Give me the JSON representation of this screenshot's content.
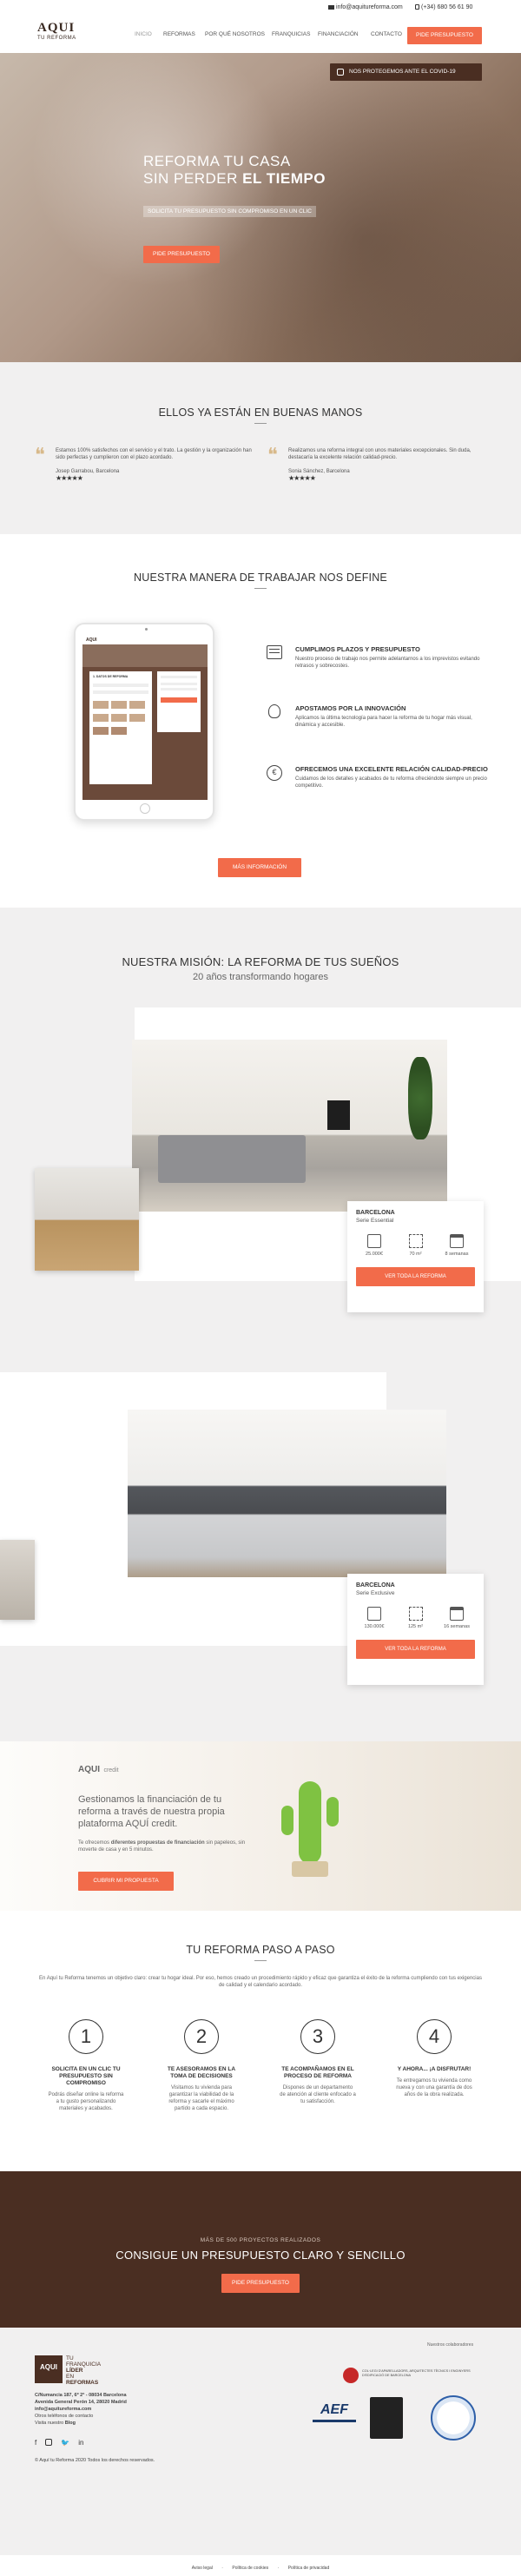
{
  "topbar": {
    "email": "info@aquitureforma.com",
    "phone": "(+34) 680 56 61 90"
  },
  "brand": {
    "logo": "AQUI",
    "tagline": "TU REFORMA"
  },
  "nav": {
    "items": [
      "INICIO",
      "REFORMAS",
      "POR QUÉ NOSOTROS",
      "FRANQUICIAS",
      "FINANCIACIÓN",
      "CONTACTO"
    ],
    "cta": "PIDE PRESUPUESTO"
  },
  "hero": {
    "covid_badge": "NOS PROTEGEMOS ANTE EL COVID-19",
    "title_line1": "REFORMA TU CASA",
    "title_line2_prefix": "SIN PERDER ",
    "title_line2_bold": "EL TIEMPO",
    "subtitle": "SOLICITA TU PRESUPUESTO SIN COMPROMISO EN UN CLIC",
    "cta": "PIDE PRESUPUESTO"
  },
  "testimonials": {
    "title": "ELLOS YA ESTÁN EN BUENAS MANOS",
    "items": [
      {
        "text": "Estamos 100% satisfechos con el servicio y el trato. La gestión y la organización han sido perfectas y cumplieron con el plazo acordado.",
        "author": "Josep Garrabou, Barcelona",
        "stars": "★★★★★"
      },
      {
        "text": "Realizamos una reforma integral con unos materiales excepcionales. Sin duda, destacaría la excelente relación calidad-precio.",
        "author": "Sonia Sánchez, Barcelona",
        "stars": "★★★★★"
      }
    ]
  },
  "method": {
    "title": "NUESTRA MANERA DE TRABAJAR NOS DEFINE",
    "features": [
      {
        "title": "CUMPLIMOS PLAZOS Y PRESUPUESTO",
        "text": "Nuestro proceso de trabajo nos permite adelantarnos a los imprevistos evitando retrasos y sobrecostes."
      },
      {
        "title": "APOSTAMOS POR LA INNOVACIÓN",
        "text": "Aplicamos la última tecnología para hacer la reforma de tu hogar más visual, dinámica y accesible."
      },
      {
        "title": "OFRECEMOS UNA EXCELENTE RELACIÓN CALIDAD-PRECIO",
        "text": "Cuidamos de los detalles y acabados de tu reforma ofreciéndote siempre un precio competitivo."
      }
    ],
    "cta": "MÁS INFORMACIÓN",
    "tablet": {
      "logo": "AQUI",
      "heading": "1. DATOS DE REFORMA"
    }
  },
  "mission": {
    "title": "NUESTRA MISIÓN: LA REFORMA DE TUS SUEÑOS",
    "subtitle": "20 años transformando hogares"
  },
  "projects": [
    {
      "city": "BARCELONA",
      "series": "Serie Essential",
      "price": "25.000€",
      "area": "70 m²",
      "weeks": "8 semanas",
      "cta": "VER TODA LA REFORMA"
    },
    {
      "city": "BARCELONA",
      "series": "Serie Exclusive",
      "price": "130.000€",
      "area": "125 m²",
      "weeks": "16 semanas",
      "cta": "VER TODA LA REFORMA"
    }
  ],
  "credit": {
    "logo": "AQUI",
    "logo_sub": "credit",
    "text": "Gestionamos la financiación de tu reforma a través de nuestra propia plataforma AQUÍ credit.",
    "detail_prefix": "Te ofrecemos ",
    "detail_bold": "diferentes propuestas de financiación",
    "detail_suffix": " sin papeleos, sin moverte de casa y en 5 minutos.",
    "cta": "CUBRIR MI PROPUESTA"
  },
  "steps": {
    "title": "TU REFORMA PASO A PASO",
    "intro": "En Aquí tu Reforma tenemos un objetivo claro: crear tu hogar ideal. Por eso, hemos creado un procedimiento rápido y eficaz que garantiza el éxito de la reforma cumpliendo con tus exigencias de calidad y el calendario acordado.",
    "items": [
      {
        "num": "1",
        "title": "SOLICITA EN UN CLIC TU PRESUPUESTO SIN COMPROMISO",
        "text": "Podrás diseñar online la reforma a tu gusto personalizando materiales y acabados."
      },
      {
        "num": "2",
        "title": "TE ASESORAMOS EN LA TOMA DE DECISIONES",
        "text": "Visitamos tu vivienda para garantizar la viabilidad de la reforma y sacarle el máximo partido a cada espacio."
      },
      {
        "num": "3",
        "title": "TE ACOMPAÑAMOS EN EL PROCESO DE REFORMA",
        "text": "Dispones de un departamento de atención al cliente enfocado a tu satisfacción."
      },
      {
        "num": "4",
        "title": "Y AHORA... ¡A DISFRUTAR!",
        "text": "Te entregamos tu vivienda como nueva y con una garantía de dos años de la obra realizada."
      }
    ]
  },
  "banner": {
    "eyebrow": "MÁS DE 500 PROYECTOS REALIZADOS",
    "title": "CONSIGUE UN PRESUPUESTO CLARO Y SENCILLO",
    "cta": "PIDE PRESUPUESTO"
  },
  "footer": {
    "badge_lines": [
      "TU",
      "FRANQUICIA",
      "LÍDER",
      "EN",
      "REFORMAS"
    ],
    "address1": "C/Numancia 187, 6º 2ª - 08034 Barcelona",
    "address2": "Avenida General Perón 14, 28020 Madrid",
    "email": "info@aquitureforma.com",
    "phones_link": "Otros teléfonos de contacto",
    "blog_prefix": "Visita nuestro ",
    "blog": "Blog",
    "collab_title": "Nuestros colaboradores",
    "collab_logo1": "COL·LEGI D'APARELLADORS, ARQUITECTES TÈCNICS I ENGINYERS D'EDIFICACIÓ DE BARCELONA",
    "collab_logo2": "AEF",
    "copyright": "© Aquí tu Reforma 2020 Todos los derechos reservados.",
    "legal": [
      "Aviso legal",
      "Política de cookies",
      "Política de privacidad"
    ]
  },
  "colors": {
    "accent": "#f26b4a",
    "dark_brown": "#4a2e22",
    "bg_gray": "#f1f0f0"
  }
}
